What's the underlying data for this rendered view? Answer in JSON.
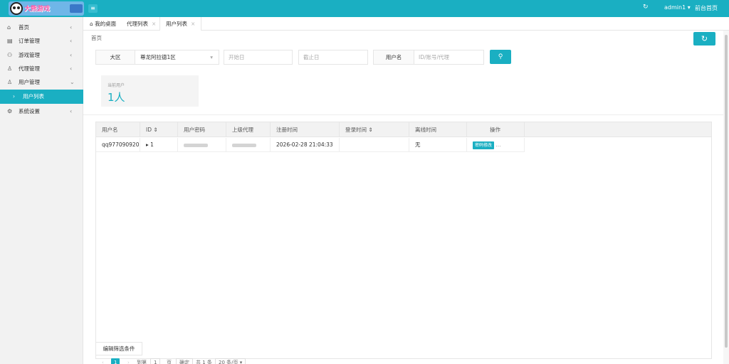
{
  "brand": {
    "logo_text": "大熊游戏"
  },
  "header": {
    "menu_icon": "menu-icon",
    "refresh_icon": "refresh-icon",
    "user": "admin1 ▾",
    "front_link": "前台首页"
  },
  "sidebar": {
    "items": [
      {
        "icon": "⌂",
        "label": "首页",
        "arrow": "‹"
      },
      {
        "icon": "▤",
        "label": "订单管理",
        "arrow": "‹"
      },
      {
        "icon": "⚇",
        "label": "游戏管理",
        "arrow": "‹"
      },
      {
        "icon": "♙",
        "label": "代理管理",
        "arrow": "‹"
      },
      {
        "icon": "♙",
        "label": "用户管理",
        "arrow": "⌄"
      },
      {
        "icon": "⚙",
        "label": "系统设置",
        "arrow": "‹"
      }
    ],
    "sub_active": {
      "arrow": "›",
      "label": "用户列表"
    }
  },
  "tabs": [
    {
      "label": "我的桌面",
      "icon": "⌂"
    },
    {
      "label": "代理列表",
      "close": "×"
    },
    {
      "label": "用户列表",
      "close": "×"
    }
  ],
  "breadcrumb": "首页",
  "filters": {
    "region_label": "大区",
    "region_value": "尊龙阿拉德1区",
    "region_caret": "▾",
    "start_date_placeholder": "开始日",
    "end_date_placeholder": "截止日",
    "username_label": "用户名",
    "username_placeholder": "ID/账号/代理"
  },
  "stat": {
    "label": "当前用户",
    "value": "1人"
  },
  "table": {
    "columns": [
      "用户名",
      "ID ⇕",
      "用户密码",
      "上级代理",
      "注册时间",
      "登录时间 ⇕",
      "离线时间",
      "操作"
    ],
    "rows": [
      {
        "username": "qq977090920",
        "id": "▸ 1",
        "register_time": "2026-02-28 21:04:33",
        "login_time": "",
        "offline_time": "无",
        "action_label": "密码修改",
        "more": "..."
      }
    ]
  },
  "edit_filter_label": "编辑筛选条件",
  "pagination": {
    "prev": "‹",
    "current": "1",
    "next": "›",
    "goto_label": "到第",
    "goto_value": "1",
    "page_unit": "页",
    "confirm": "确定",
    "total": "共 1 条",
    "page_size": "20 条/页 ▾"
  },
  "colors": {
    "accent": "#1aafc2"
  }
}
